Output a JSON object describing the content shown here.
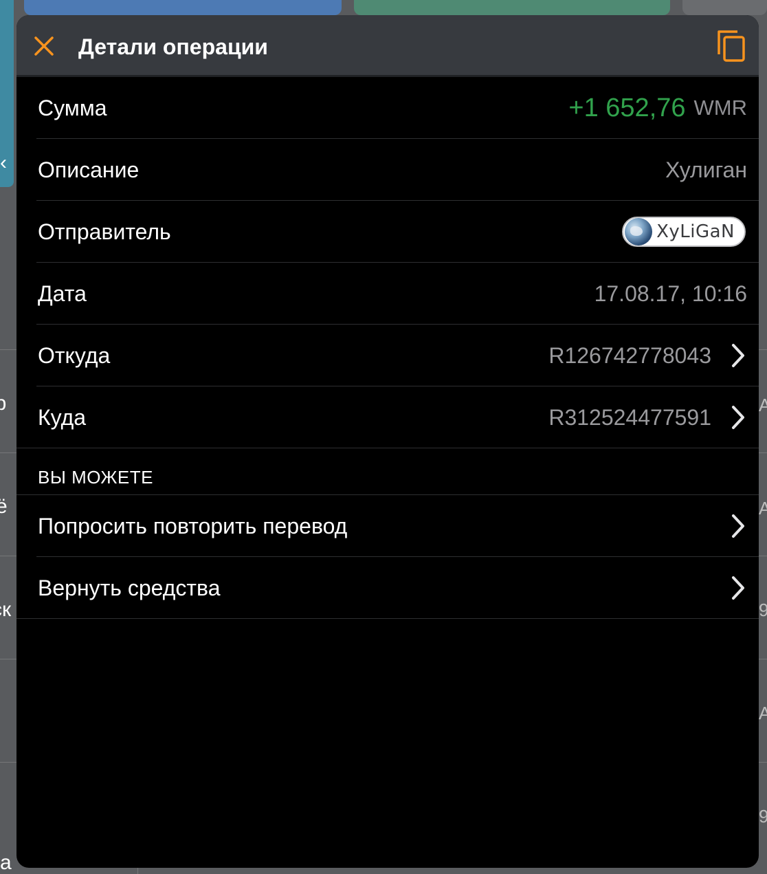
{
  "modal": {
    "title": "Детали операции",
    "close_icon": "close-icon",
    "copy_icon": "copy-icon",
    "accent_color": "#f7931e"
  },
  "details": {
    "amount": {
      "label": "Сумма",
      "value": "+1 652,76",
      "currency": "WMR",
      "value_color": "#31a24c"
    },
    "description": {
      "label": "Описание",
      "value": "Хулиган"
    },
    "sender": {
      "label": "Отправитель",
      "name": "XyLiGaN",
      "avatar_icon": "avatar-image"
    },
    "date": {
      "label": "Дата",
      "value": "17.08.17, 10:16"
    },
    "from": {
      "label": "Откуда",
      "value": "R126742778043"
    },
    "to": {
      "label": "Куда",
      "value": "R312524477591"
    }
  },
  "actions": {
    "header": "ВЫ МОЖЕТЕ",
    "items": [
      {
        "label": "Попросить повторить перевод"
      },
      {
        "label": "Вернуть средства"
      }
    ]
  },
  "background": {
    "left_glyphs": [
      "‹",
      "ір",
      "ё",
      "ск",
      "а"
    ],
    "right_glyphs": [
      "A",
      "A",
      "9",
      "A",
      "9"
    ]
  }
}
